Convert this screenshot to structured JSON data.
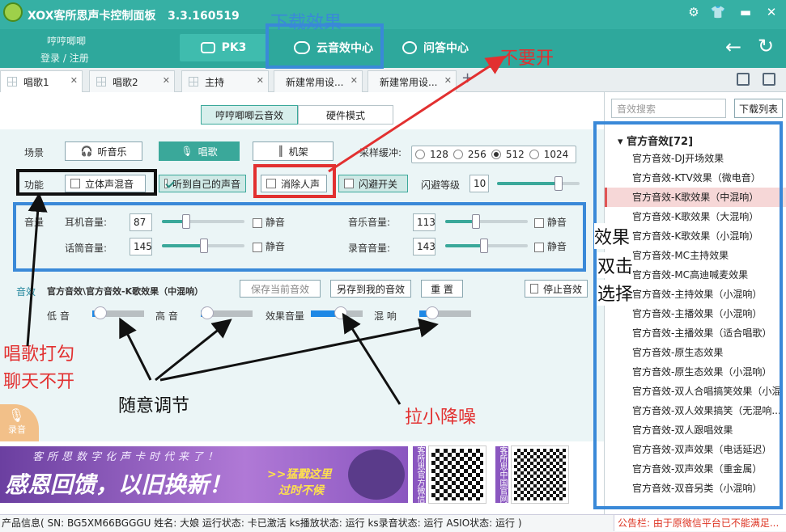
{
  "app": {
    "title": "XOX客所思声卡控制面板",
    "version": "3.3.160519"
  },
  "user": {
    "name": "哼哼唧唧",
    "login": "登录",
    "sep": "/",
    "register": "注册"
  },
  "nav": {
    "pk3": "PK3",
    "cloud": "云音效中心",
    "qa": "问答中心"
  },
  "tabs": [
    {
      "label": "唱歌1"
    },
    {
      "label": "唱歌2"
    },
    {
      "label": "主持"
    },
    {
      "label": "新建常用设..."
    },
    {
      "label": "新建常用设..."
    }
  ],
  "mode": {
    "cloud": "哼哼唧唧云音效",
    "hardware": "硬件模式"
  },
  "scene": {
    "label": "场景",
    "listen": "听音乐",
    "sing": "唱歌",
    "rack": "机架",
    "sample_label": "采样缓冲:",
    "samples": [
      "128",
      "256",
      "512",
      "1024"
    ],
    "sample_selected": "512"
  },
  "func": {
    "label": "功能",
    "stereo": "立体声混音",
    "hear_self": "听到自己的声音",
    "remove_vocal": "消除人声",
    "dodge_switch": "闪避开关",
    "dodge_level_label": "闪避等级",
    "dodge_level": "10",
    "dodge_level_slider": 0.75
  },
  "volume": {
    "label": "音量",
    "earphone_label": "耳机音量:",
    "earphone": "87",
    "earphone_level": 0.3,
    "music_label": "音乐音量:",
    "music": "113",
    "music_level": 0.38,
    "mic_label": "话筒音量:",
    "mic": "145",
    "mic_level": 0.52,
    "record_label": "录音音量:",
    "record": "143",
    "record_level": 0.48,
    "mute": "静音"
  },
  "effect": {
    "label": "音效",
    "path": "官方音效\\官方音效-K歌效果（中混响）",
    "save_current": "保存当前音效",
    "save_as_mine": "另存到我的音效",
    "reset": "重 置",
    "stop": "停止音效",
    "bass": "低 音",
    "bass_level": 0.12,
    "treble": "高 音",
    "treble_level": 0.1,
    "effect_volume": "效果音量",
    "effect_volume_level": 0.55,
    "reverb": "混 响",
    "reverb_level": 0.22
  },
  "record_btn": "录音",
  "sidebar": {
    "search_placeholder": "音效搜索",
    "download_list": "下载列表",
    "group": "官方音效[72]",
    "items": [
      "官方音效-DJ开场效果",
      "官方音效-KTV效果（微电音）",
      "官方音效-K歌效果（中混响）",
      "官方音效-K歌效果（大混响）",
      "官方音效-K歌效果（小混响）",
      "官方音效-MC主持效果",
      "官方音效-MC高迪喊麦效果",
      "官方音效-主持效果（小混响）",
      "官方音效-主播效果（小混响）",
      "官方音效-主播效果（适合唱歌）",
      "官方音效-原生态效果",
      "官方音效-原生态效果（小混响）",
      "官方音效-双人合唱搞笑效果（小混",
      "官方音效-双人效果搞笑（无混响...",
      "官方音效-双人跟唱效果",
      "官方音效-双声效果（电话延迟）",
      "官方音效-双声效果（重金属）",
      "官方音效-双音另类（小混响）"
    ],
    "selected_index": 2
  },
  "banner": {
    "top_line": "客所思数字化声卡时代来了！",
    "slogan": "感恩回馈，以旧换新！",
    "cta1": ">>猛戳这里",
    "cta2": "过时不候",
    "wechat_label": "客所思官方微信",
    "site_label": "客所思中国官网"
  },
  "status": {
    "text": "产品信息( SN: BG5XM66BGGGU  姓名: 大娘  运行状态: 卡已激活  ks播放状态: 运行  ks录音状态: 运行  ASIO状态: 运行 )",
    "notice": "公告栏: 由于原微信平台已不能满足..."
  },
  "annotations": {
    "download": "下载效果",
    "dont_enable": "不要开",
    "sing_check": "唱歌打勾",
    "chat_off": "聊天不开",
    "adjust": "随意调节",
    "lower_noise": "拉小降噪",
    "dbl1": "效果",
    "dbl2": "双击",
    "dbl3": "选择"
  },
  "colors": {
    "teal": "#36b0a4",
    "accent_red": "#e23030",
    "annotation_blue": "#3a89d8"
  }
}
